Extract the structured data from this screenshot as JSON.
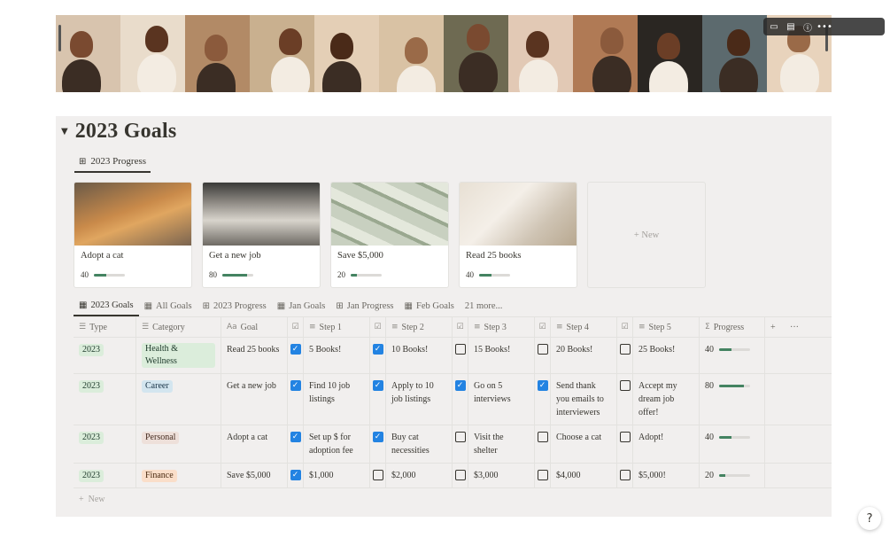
{
  "banner": {
    "tools": [
      {
        "icon": "comment-icon",
        "glyph": "▭"
      },
      {
        "icon": "history-icon",
        "glyph": "▤"
      },
      {
        "icon": "info-icon",
        "glyph": "ⓘ"
      },
      {
        "icon": "more-icon",
        "glyph": "•••"
      }
    ],
    "panel_colors": [
      "#d8c4ae",
      "#e9dccb",
      "#b28a66",
      "#c9b08f",
      "#e4cfb6",
      "#d9c2a4",
      "#6e6a52",
      "#e2c9b5",
      "#b07a55",
      "#2a2622",
      "#5c6a6e",
      "#e8d3bc"
    ]
  },
  "page": {
    "toggle": "▼",
    "title": "2023 Goals"
  },
  "view_tab": {
    "icon": "gallery-icon",
    "label": "2023 Progress"
  },
  "gallery": {
    "cards": [
      {
        "name": "Adopt a cat",
        "progress": 40,
        "progress_label": "40",
        "image": "cat-photo"
      },
      {
        "name": "Get a new job",
        "progress": 80,
        "progress_label": "80",
        "image": "office-photo"
      },
      {
        "name": "Save $5,000",
        "progress": 20,
        "progress_label": "20",
        "image": "money-photo"
      },
      {
        "name": "Read 25 books",
        "progress": 40,
        "progress_label": "40",
        "image": "books-photo"
      }
    ],
    "new_label": "+ New"
  },
  "db_tabs": [
    {
      "icon": "table-icon",
      "glyph": "▦",
      "label": "2023 Goals",
      "active": true
    },
    {
      "icon": "table-icon",
      "glyph": "▦",
      "label": "All Goals",
      "active": false
    },
    {
      "icon": "gallery-icon",
      "glyph": "⊞",
      "label": "2023 Progress",
      "active": false
    },
    {
      "icon": "table-icon",
      "glyph": "▦",
      "label": "Jan Goals",
      "active": false
    },
    {
      "icon": "gallery-icon",
      "glyph": "⊞",
      "label": "Jan Progress",
      "active": false
    },
    {
      "icon": "table-icon",
      "glyph": "▦",
      "label": "Feb Goals",
      "active": false
    },
    {
      "icon": "",
      "glyph": "",
      "label": "21 more...",
      "active": false
    }
  ],
  "table": {
    "headers": {
      "type": "Type",
      "category": "Category",
      "goal": "Goal",
      "step1": "Step 1",
      "step2": "Step 2",
      "step3": "Step 3",
      "step4": "Step 4",
      "step5": "Step 5",
      "progress": "Progress",
      "add": "+",
      "more": "···"
    },
    "rows": [
      {
        "type": "2023",
        "category": "Health & Wellness",
        "category_color": "green",
        "goal": "Read 25 books",
        "steps": [
          {
            "done": true,
            "text": "5 Books!"
          },
          {
            "done": true,
            "text": "10 Books!"
          },
          {
            "done": false,
            "text": "15 Books!"
          },
          {
            "done": false,
            "text": "20 Books!"
          },
          {
            "done": false,
            "text": "25 Books!"
          }
        ],
        "progress": 40,
        "progress_label": "40"
      },
      {
        "type": "2023",
        "category": "Career",
        "category_color": "blue",
        "goal": "Get a new job",
        "steps": [
          {
            "done": true,
            "text": "Find 10 job listings"
          },
          {
            "done": true,
            "text": "Apply to 10 job listings"
          },
          {
            "done": true,
            "text": "Go on 5 interviews"
          },
          {
            "done": true,
            "text": "Send thank you emails to interviewers"
          },
          {
            "done": false,
            "text": "Accept my dream job offer!"
          }
        ],
        "progress": 80,
        "progress_label": "80"
      },
      {
        "type": "2023",
        "category": "Personal",
        "category_color": "brown",
        "goal": "Adopt a cat",
        "steps": [
          {
            "done": true,
            "text": "Set up $ for adoption fee"
          },
          {
            "done": true,
            "text": "Buy cat necessities"
          },
          {
            "done": false,
            "text": "Visit the shelter"
          },
          {
            "done": false,
            "text": "Choose a cat"
          },
          {
            "done": false,
            "text": "Adopt!"
          }
        ],
        "progress": 40,
        "progress_label": "40"
      },
      {
        "type": "2023",
        "category": "Finance",
        "category_color": "orange",
        "goal": "Save $5,000",
        "steps": [
          {
            "done": true,
            "text": "$1,000"
          },
          {
            "done": false,
            "text": "$2,000"
          },
          {
            "done": false,
            "text": "$3,000"
          },
          {
            "done": false,
            "text": "$4,000"
          },
          {
            "done": false,
            "text": "$5,000!"
          }
        ],
        "progress": 20,
        "progress_label": "20"
      }
    ],
    "new_label": "New"
  },
  "help": {
    "label": "?"
  }
}
